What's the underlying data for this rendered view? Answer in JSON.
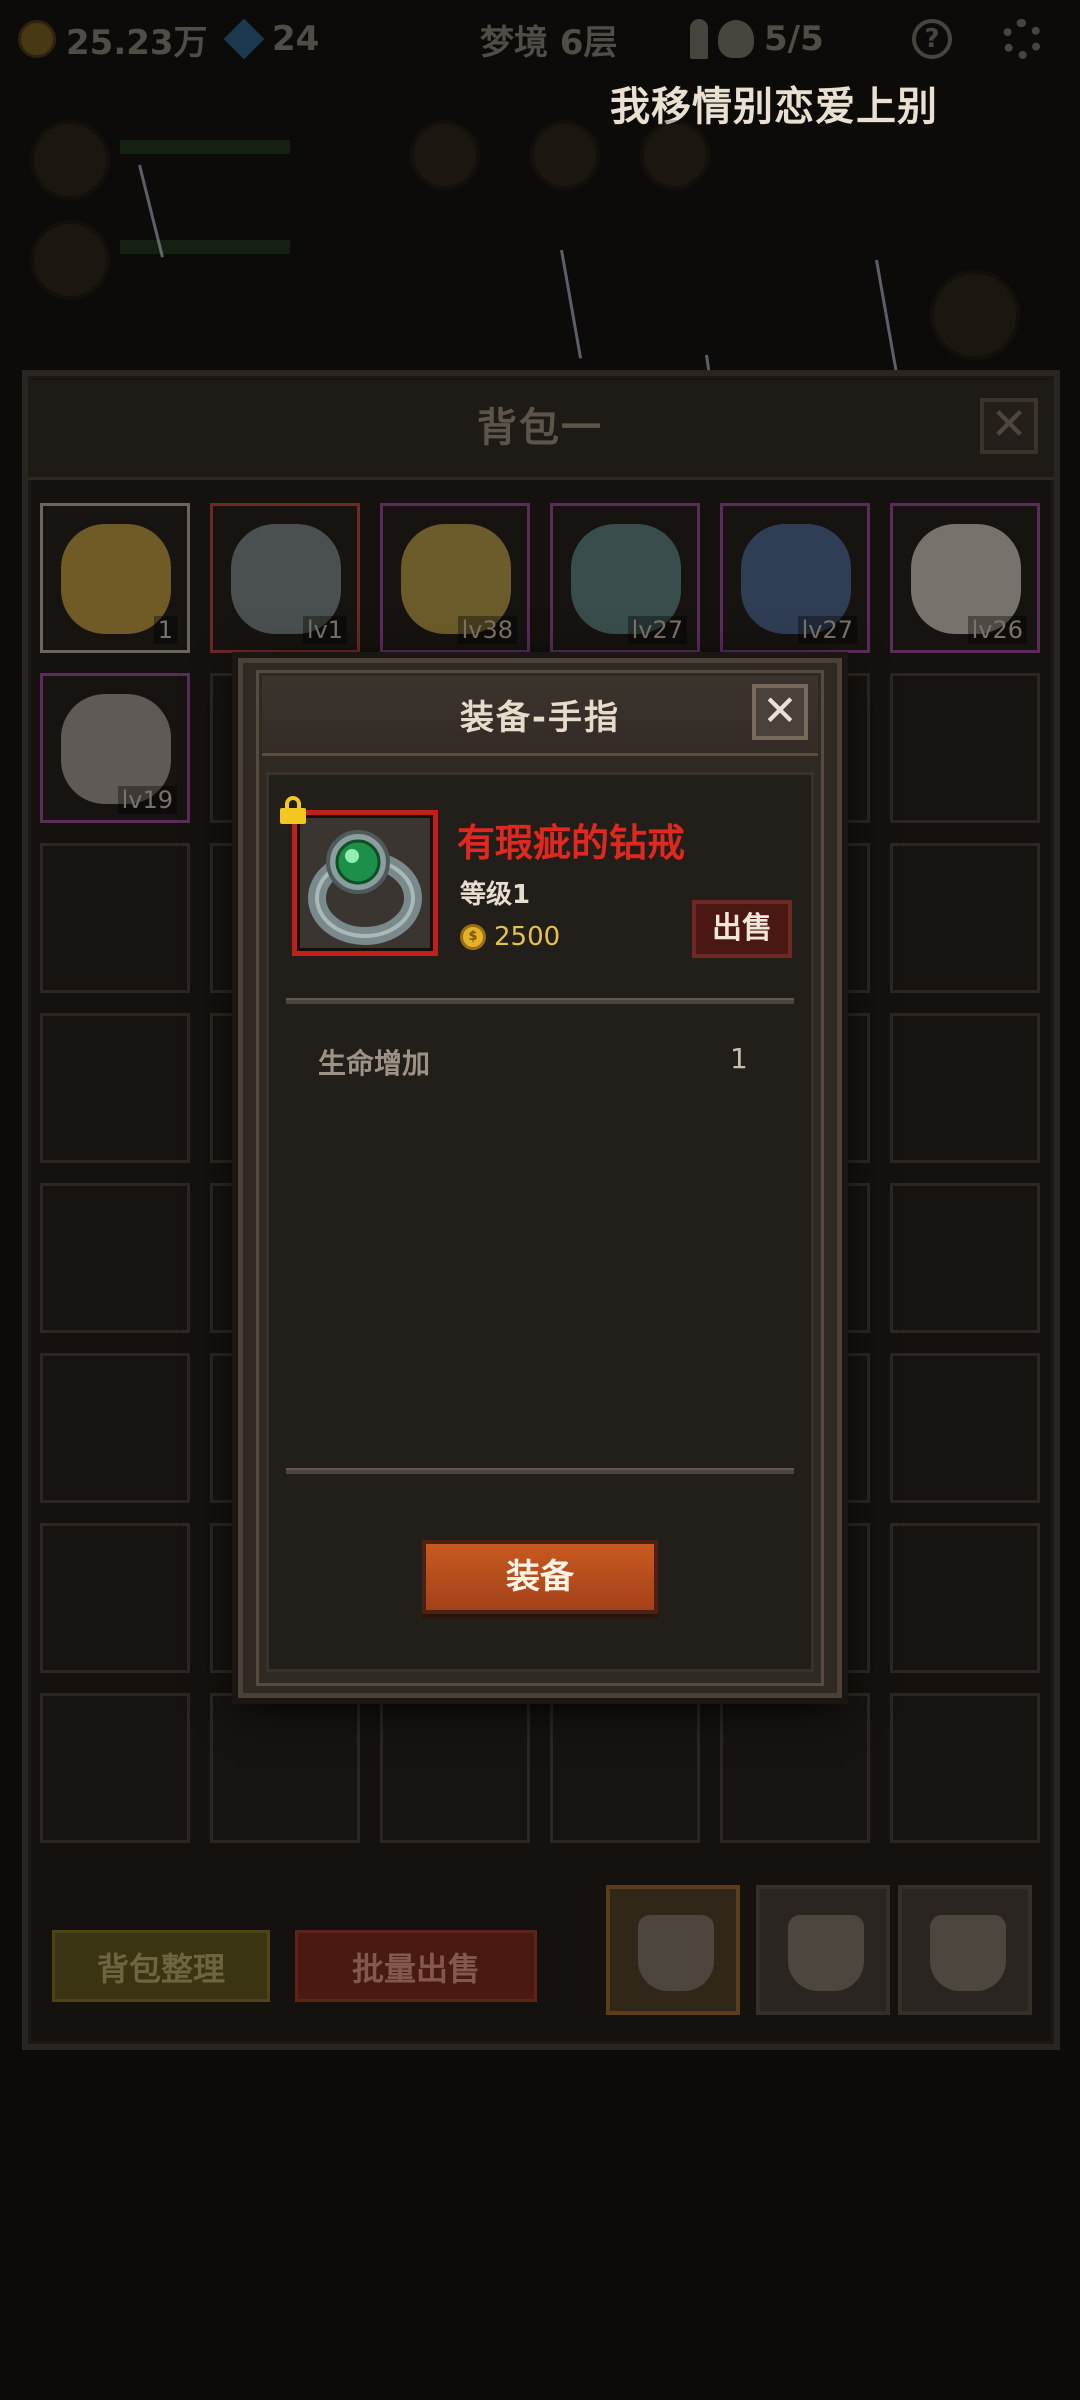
{
  "hud": {
    "gold": "25.23万",
    "gems": "24",
    "floor": "梦境 6层",
    "skulls": "5/5"
  },
  "marquee": {
    "text": "我移情别恋爱上别"
  },
  "bag": {
    "title": "背包一",
    "close": "✕",
    "items": [
      {
        "level": "1",
        "art": "cheese"
      },
      {
        "level": "lv1",
        "art": "ring"
      },
      {
        "level": "lv38",
        "art": "shield"
      },
      {
        "level": "lv27",
        "art": "net"
      },
      {
        "level": "lv27",
        "art": "boots"
      },
      {
        "level": "lv26",
        "art": "blade"
      },
      {
        "level": "lv19",
        "art": "bow"
      }
    ],
    "sort_label": "背包整理",
    "batch_sell_label": "批量出售"
  },
  "modal": {
    "title": "装备-手指",
    "close": "✕",
    "item": {
      "name": "有瑕疵的钻戒",
      "level": "等级1",
      "coin_symbol": "$",
      "price": "2500",
      "locked": true
    },
    "sell_label": "出售",
    "stats": [
      {
        "label": "生命增加",
        "value": "1"
      }
    ],
    "equip_label": "装备"
  },
  "colors": {
    "item_name": "#e0281f",
    "equip_button": "#c75a1f",
    "price": "#e6c24a",
    "lock": "#f2c720"
  }
}
